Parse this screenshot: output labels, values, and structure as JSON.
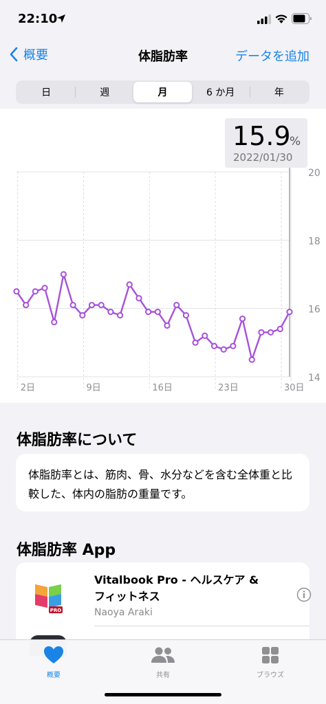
{
  "status": {
    "time": "22:10"
  },
  "nav": {
    "back_label": "概要",
    "title": "体脂肪率",
    "add_label": "データを追加"
  },
  "segments": [
    {
      "label": "日",
      "active": false
    },
    {
      "label": "週",
      "active": false
    },
    {
      "label": "月",
      "active": true
    },
    {
      "label": "6 か月",
      "active": false
    },
    {
      "label": "年",
      "active": false
    }
  ],
  "tooltip": {
    "value": "15.9",
    "unit": "%",
    "date": "2022/01/30"
  },
  "chart_data": {
    "type": "line",
    "x": [
      1,
      2,
      3,
      4,
      5,
      6,
      7,
      8,
      9,
      10,
      11,
      12,
      13,
      14,
      15,
      16,
      17,
      18,
      19,
      20,
      21,
      22,
      23,
      24,
      25,
      26,
      27,
      28,
      29,
      30
    ],
    "series": [
      {
        "values": [
          16.5,
          16.1,
          16.5,
          16.6,
          15.6,
          17.0,
          16.1,
          15.8,
          16.1,
          16.1,
          15.9,
          15.8,
          16.7,
          16.3,
          15.9,
          15.9,
          15.5,
          16.1,
          15.8,
          15.0,
          15.2,
          14.9,
          14.8,
          14.9,
          15.7,
          14.5,
          15.3,
          15.3,
          15.4,
          15.9
        ]
      }
    ],
    "x_tick_labels": [
      "2日",
      "9日",
      "16日",
      "23日",
      "30日"
    ],
    "x_tick_values": [
      2,
      9,
      16,
      23,
      30
    ],
    "y_tick_labels": [
      "20",
      "18",
      "16",
      "14"
    ],
    "ylim": [
      14,
      20
    ],
    "selected_x": 30,
    "line_color": "#a651d9",
    "grid": true
  },
  "about": {
    "title": "体脂肪率について",
    "text": "体脂肪率とは、筋肉、骨、水分などを含む全体重と比較した、体内の脂肪の重量です。"
  },
  "apps": {
    "title": "体脂肪率 App",
    "items": [
      {
        "name": "Vitalbook Pro - ヘルスケア & フィットネス",
        "developer": "Naoya Araki",
        "icon_badge": "PRO"
      }
    ]
  },
  "tabbar": [
    {
      "label": "概要",
      "icon": "heart-icon",
      "active": true
    },
    {
      "label": "共有",
      "icon": "people-icon",
      "active": false
    },
    {
      "label": "ブラウズ",
      "icon": "grid-icon",
      "active": false
    }
  ],
  "colors": {
    "accent": "#1a84e6",
    "chart_line": "#a651d9",
    "background": "#f2f2f7"
  }
}
